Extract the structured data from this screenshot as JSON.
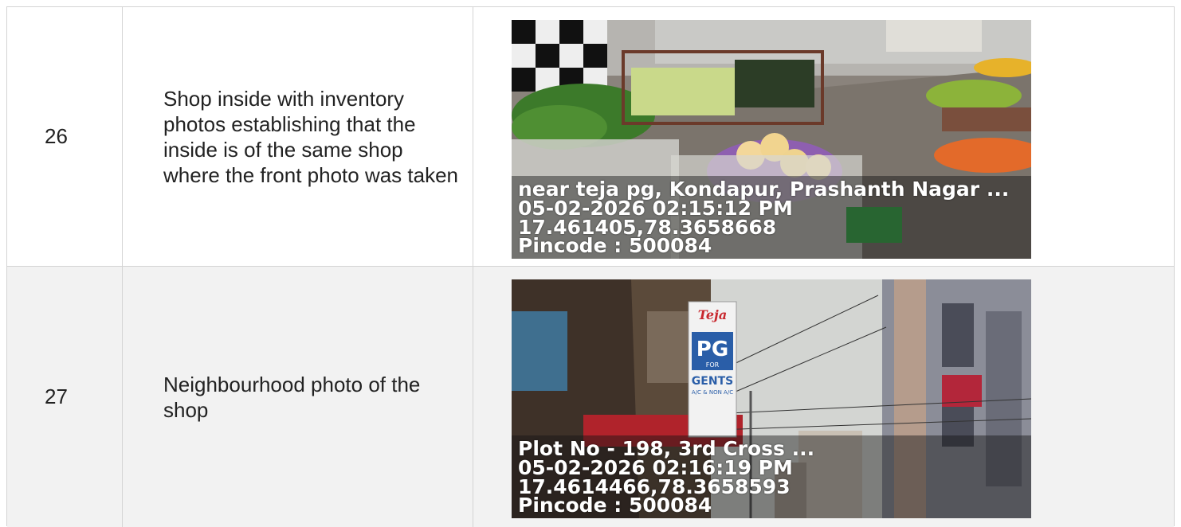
{
  "rows": [
    {
      "number": "26",
      "description": "Shop inside with inventory photos establishing that the inside is of the same shop where the front photo was taken",
      "photo": {
        "subject": "vegetable-stall-interior",
        "stamp": {
          "address": "near teja pg, Kondapur, Prashanth Nagar ...",
          "datetime": "05-02-2026 02:15:12 PM",
          "coords": "17.461405,78.3658668",
          "pincode": "Pincode : 500084"
        }
      }
    },
    {
      "number": "27",
      "description": "Neighbourhood photo of the shop",
      "photo": {
        "subject": "street-neighbourhood",
        "sign_top": "Teja",
        "sign_mid": "PG",
        "sign_for": "FOR",
        "sign_bottom": "GENTS",
        "sign_sub": "A/C & NON A/C",
        "stamp": {
          "address": "Plot No - 198, 3rd Cross ...",
          "datetime": "05-02-2026 02:16:19 PM",
          "coords": "17.4614466,78.3658593",
          "pincode": "Pincode : 500084"
        }
      }
    }
  ]
}
